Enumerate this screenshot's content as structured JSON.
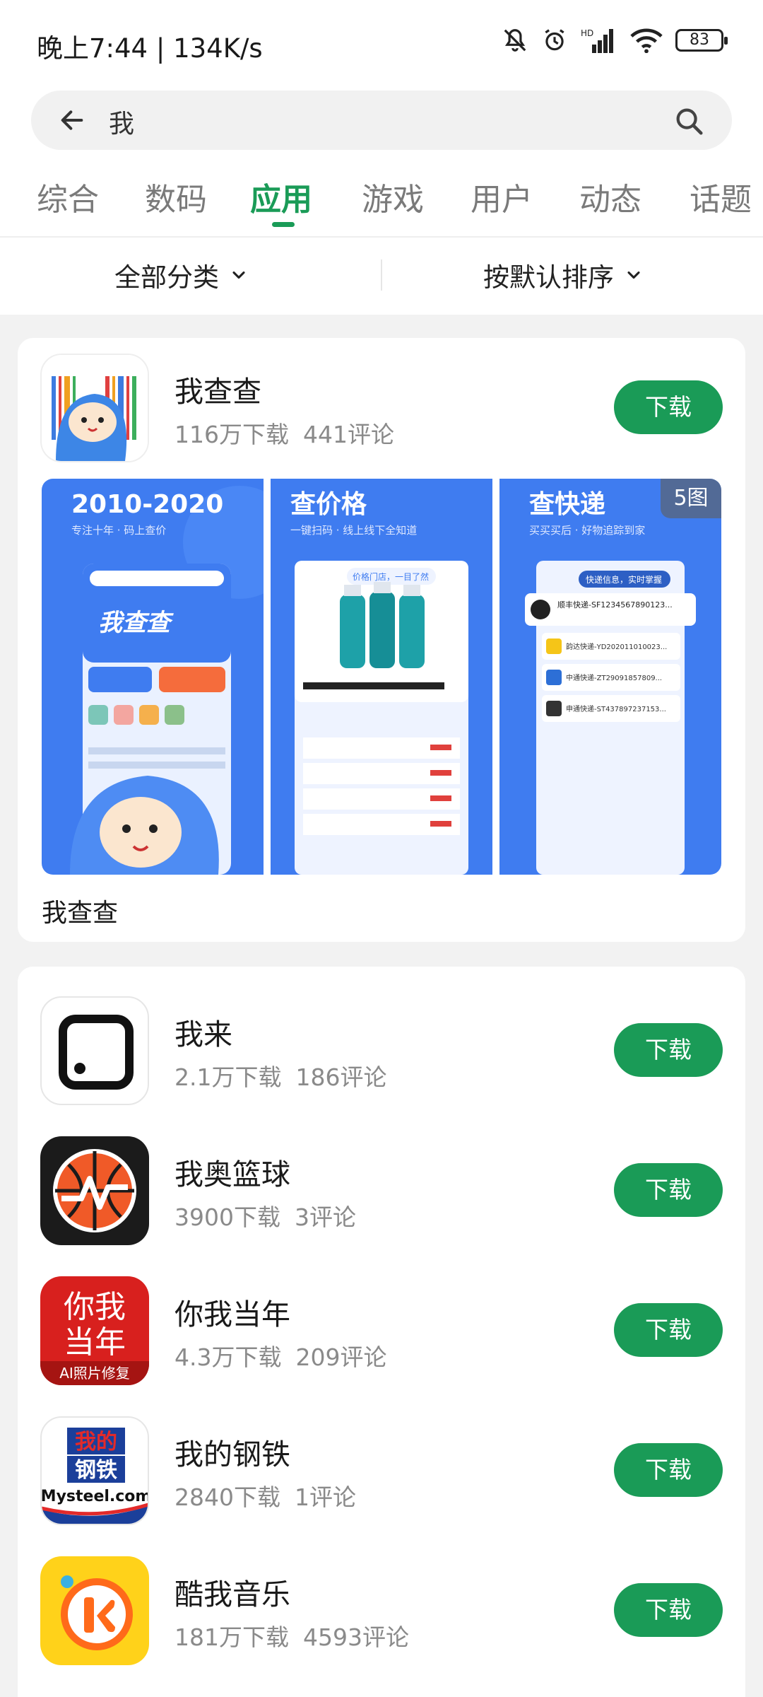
{
  "status_bar": {
    "time": "晚上7:44 | 134K/s",
    "battery": "83"
  },
  "search": {
    "query": "我"
  },
  "tabs": [
    {
      "label": "综合",
      "active": false
    },
    {
      "label": "数码",
      "active": false
    },
    {
      "label": "应用",
      "active": true
    },
    {
      "label": "游戏",
      "active": false
    },
    {
      "label": "用户",
      "active": false
    },
    {
      "label": "动态",
      "active": false
    },
    {
      "label": "话题",
      "active": false
    }
  ],
  "filters": {
    "category": "全部分类",
    "sort": "按默认排序"
  },
  "accent_color": "#1a9b57",
  "featured": {
    "name": "我查查",
    "downloads": "116万下载",
    "comments": "441评论",
    "button": "下载",
    "caption": "我查查",
    "badge": "5图",
    "screenshots": [
      {
        "title": "2010-2020",
        "subtitle": "专注十年 · 码上查价",
        "hero": "我查查"
      },
      {
        "title": "查价格",
        "subtitle": "一键扫码 · 线上线下全知道",
        "bubble": "价格门店，一目了然"
      },
      {
        "title": "查快递",
        "subtitle": "买买买后 · 好物追踪到家",
        "bubble": "快递信息，实时掌握",
        "items": [
          "顺丰快递-SF1234567890123...",
          "韵达快递-YD202011010023...",
          "中通快递-ZT290918578​09...",
          "申通快递-ST43789723715​3..."
        ]
      }
    ]
  },
  "apps": [
    {
      "name": "我来",
      "downloads": "2.1万下载",
      "comments": "186评论",
      "button": "下载",
      "icon": "wolai-icon"
    },
    {
      "name": "我奥篮球",
      "downloads": "3900下载",
      "comments": "3评论",
      "button": "下载",
      "icon": "basketball-icon"
    },
    {
      "name": "你我当年",
      "downloads": "4.3万下载",
      "comments": "209评论",
      "button": "下载",
      "icon": "niwodangnian-icon",
      "icon_text": {
        "line1": "你我",
        "line2": "当年",
        "tag": "AI照片修复"
      }
    },
    {
      "name": "我的钢铁",
      "downloads": "2840下载",
      "comments": "1评论",
      "button": "下载",
      "icon": "mysteel-icon",
      "icon_text": {
        "line1": "我的",
        "line2": "钢铁",
        "tag": "Mysteel.com"
      }
    },
    {
      "name": "酷我音乐",
      "downloads": "181万下载",
      "comments": "4593评论",
      "button": "下载",
      "icon": "kuwo-music-icon"
    }
  ]
}
